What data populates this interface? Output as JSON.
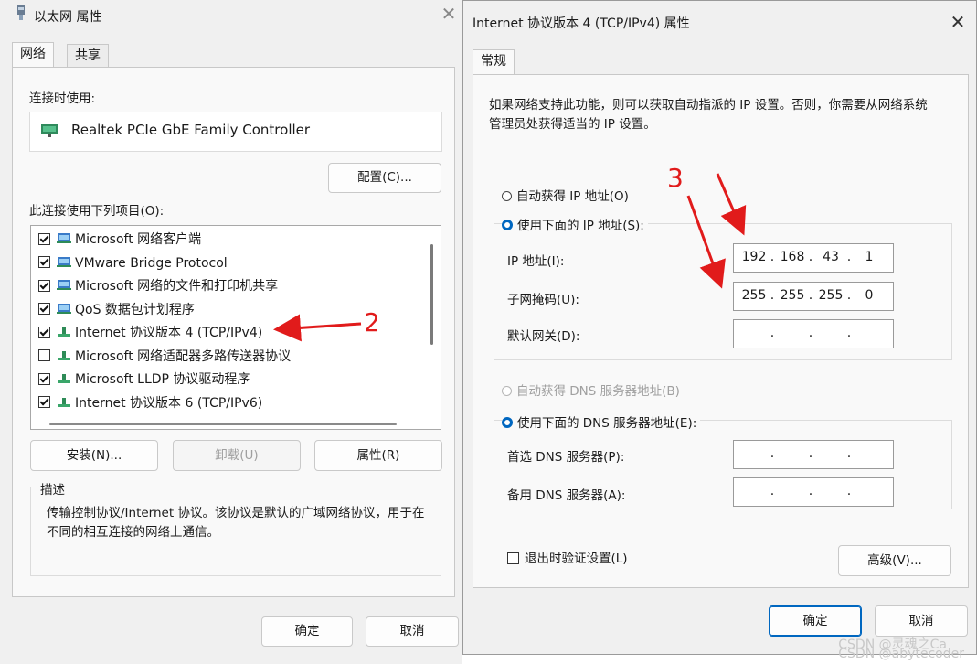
{
  "left_window": {
    "title": "以太网 属性",
    "tabs": [
      "网络",
      "共享"
    ],
    "connect_using_label": "连接时使用:",
    "adapter_name": "Realtek PCIe GbE Family Controller",
    "configure_button": "配置(C)...",
    "items_label": "此连接使用下列项目(O):",
    "items": [
      {
        "label": "Microsoft 网络客户端",
        "checked": true,
        "icon": "network-client-icon"
      },
      {
        "label": "VMware Bridge Protocol",
        "checked": true,
        "icon": "network-client-icon"
      },
      {
        "label": "Microsoft 网络的文件和打印机共享",
        "checked": true,
        "icon": "network-client-icon"
      },
      {
        "label": "QoS 数据包计划程序",
        "checked": true,
        "icon": "network-client-icon"
      },
      {
        "label": "Internet 协议版本 4 (TCP/IPv4)",
        "checked": true,
        "icon": "protocol-icon"
      },
      {
        "label": "Microsoft 网络适配器多路传送器协议",
        "checked": false,
        "icon": "protocol-icon"
      },
      {
        "label": "Microsoft LLDP 协议驱动程序",
        "checked": true,
        "icon": "protocol-icon"
      },
      {
        "label": "Internet 协议版本 6 (TCP/IPv6)",
        "checked": true,
        "icon": "protocol-icon"
      }
    ],
    "install_button": "安装(N)...",
    "uninstall_button": "卸载(U)",
    "properties_button": "属性(R)",
    "description_label": "描述",
    "description_text": "传输控制协议/Internet 协议。该协议是默认的广域网络协议，用于在不同的相互连接的网络上通信。",
    "ok_button": "确定",
    "cancel_button": "取消"
  },
  "right_window": {
    "title": "Internet 协议版本 4 (TCP/IPv4) 属性",
    "tab": "常规",
    "intro_text": "如果网络支持此功能，则可以获取自动指派的 IP 设置。否则，你需要从网络系统管理员处获得适当的 IP 设置。",
    "auto_ip_label": "自动获得 IP 地址(O)",
    "manual_ip_label": "使用下面的 IP 地址(S):",
    "ip_address_label": "IP 地址(I):",
    "ip_address": [
      "192",
      "168",
      "43",
      "1"
    ],
    "subnet_mask_label": "子网掩码(U):",
    "subnet_mask": [
      "255",
      "255",
      "255",
      "0"
    ],
    "gateway_label": "默认网关(D):",
    "auto_dns_label": "自动获得 DNS 服务器地址(B)",
    "manual_dns_label": "使用下面的 DNS 服务器地址(E):",
    "preferred_dns_label": "首选 DNS 服务器(P):",
    "alternate_dns_label": "备用 DNS 服务器(A):",
    "validate_label": "退出时验证设置(L)",
    "advanced_button": "高级(V)...",
    "ok_button": "确定",
    "cancel_button": "取消"
  },
  "annotations": {
    "step2": "2",
    "step3": "3",
    "color": "#e11b1b"
  },
  "watermark": "CSDN @灵魂之Ca\nCSDN @abytecoder"
}
